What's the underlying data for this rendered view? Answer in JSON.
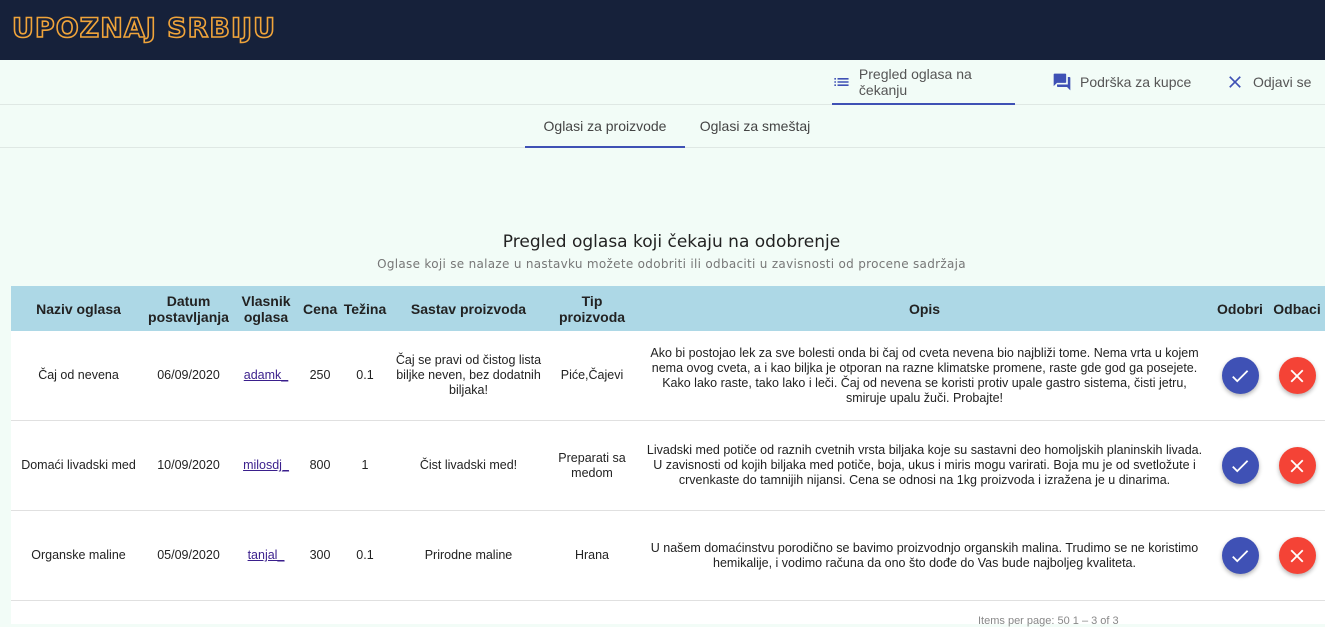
{
  "app": {
    "logo": "UPOZNAJ SRBIJU"
  },
  "nav": {
    "items": [
      {
        "label": "Pregled oglasa na čekanju",
        "icon": "list-icon"
      },
      {
        "label": "Podrška za kupce",
        "icon": "forum-icon"
      },
      {
        "label": "Odjavi se",
        "icon": "close-icon"
      }
    ]
  },
  "tabs": [
    {
      "label": "Oglasi za proizvode",
      "active": true
    },
    {
      "label": "Oglasi za smeštaj",
      "active": false
    }
  ],
  "page": {
    "title": "Pregled oglasa koji čekaju na odobrenje",
    "subtitle": "Oglase koji se nalaze u nastavku možete odobriti ili odbaciti u zavisnosti od procene sadržaja"
  },
  "table": {
    "headers": [
      "Naziv oglasa",
      "Datum postavljanja",
      "Vlasnik oglasa",
      "Cena",
      "Težina",
      "Sastav proizvoda",
      "Tip proizvoda",
      "Opis",
      "Odobri",
      "Odbaci"
    ],
    "rows": [
      {
        "naziv": "Čaj od nevena",
        "datum": "06/09/2020",
        "vlasnik": "adamk_",
        "cena": "250",
        "tezina": "0.1",
        "sastav": "Čaj se pravi od čistog lista biljke neven, bez dodatnih biljaka!",
        "tip": "Piće,Čajevi",
        "opis": "Ako bi postojao lek za sve bolesti onda bi čaj od cveta nevena bio najbliži tome. Nema vrta u kojem nema ovog cveta, a i kao biljka je otporan na razne klimatske promene, raste gde god ga posejete. Kako lako raste, tako lako i leči. Čaj od nevena se koristi protiv upale gastro sistema, čisti jetru, smiruje upalu žuči. Probajte!"
      },
      {
        "naziv": "Domaći livadski med",
        "datum": "10/09/2020",
        "vlasnik": "milosdj_",
        "cena": "800",
        "tezina": "1",
        "sastav": "Čist livadski med!",
        "tip": "Preparati sa medom",
        "opis": "Livadski med potiče od raznih cvetnih vrsta biljaka koje su sastavni deo homoljskih planinskih livada. U zavisnosti od kojih biljaka med potiče, boja, ukus i miris mogu varirati. Boja mu je od svetložute i crvenkaste do tamnijih nijansi. Cena se odnosi na 1kg proizvoda i izražena je u dinarima."
      },
      {
        "naziv": "Organske maline",
        "datum": "05/09/2020",
        "vlasnik": "tanjal_",
        "cena": "300",
        "tezina": "0.1",
        "sastav": "Prirodne maline",
        "tip": "Hrana",
        "opis": "U našem domaćinstvu porodično se bavimo proizvodnjo organskih malina. Trudimo se ne koristimo hemikalije, i vodimo računa da ono što dođe do Vas bude najboljeg kvaliteta."
      }
    ]
  },
  "pagination": {
    "text": "Items per page: 50   1 – 3 of 3"
  },
  "colors": {
    "topbar": "#16213a",
    "logo": "#f0a43a",
    "header_row": "#add8e6",
    "approve": "#3f51b5",
    "reject": "#f44336",
    "background": "#f2fcf7"
  }
}
